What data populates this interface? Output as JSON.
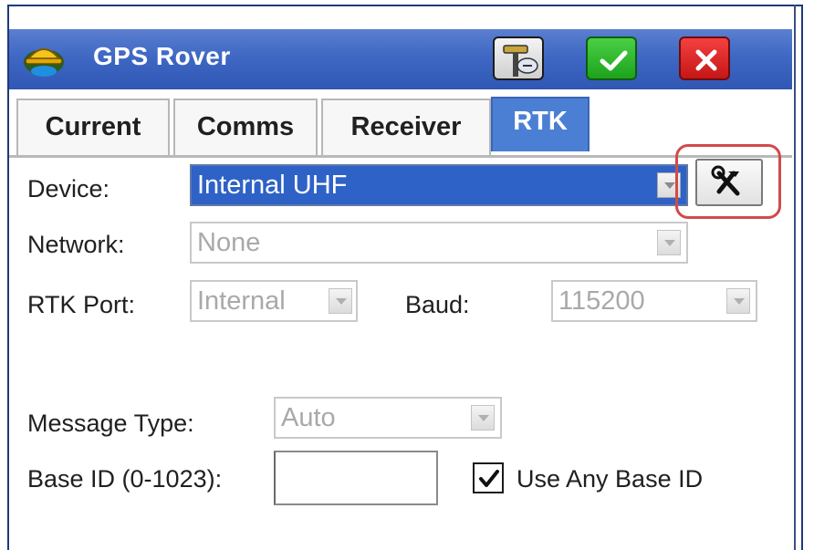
{
  "window": {
    "title": "GPS Rover",
    "icons": {
      "app": "helmet-icon",
      "survey": "survey-rod-icon",
      "ok": "checkmark-icon",
      "cancel": "close-icon"
    }
  },
  "tabs": [
    {
      "label": "Current",
      "active": false
    },
    {
      "label": "Comms",
      "active": false
    },
    {
      "label": "Receiver",
      "active": false
    },
    {
      "label": "RTK",
      "active": true
    }
  ],
  "form": {
    "device": {
      "label": "Device:",
      "value": "Internal UHF"
    },
    "network": {
      "label": "Network:",
      "value": "None"
    },
    "rtk_port": {
      "label": "RTK Port:",
      "value": "Internal"
    },
    "baud": {
      "label": "Baud:",
      "value": "115200"
    },
    "message_type": {
      "label": "Message Type:",
      "value": "Auto"
    },
    "base_id": {
      "label": "Base ID (0-1023):",
      "value": ""
    },
    "use_any_base_id": {
      "label": "Use Any Base ID",
      "checked": true
    },
    "tools_icon": "tools-icon"
  },
  "colors": {
    "titlebar": "#3f68c4",
    "active_tab": "#4b7fd3",
    "ok_button": "#1ea21c",
    "cancel_button": "#c51616",
    "highlight": "#d24a4a"
  }
}
